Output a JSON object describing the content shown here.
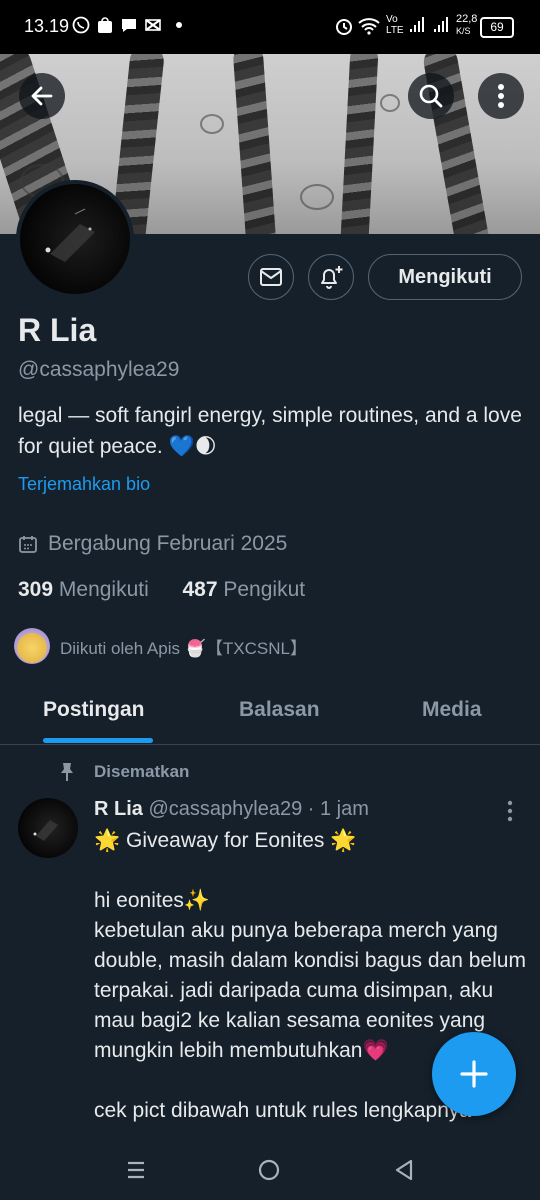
{
  "status_bar": {
    "time": "13.19",
    "network_speed": "22,8",
    "speed_unit": "K/S",
    "carrier_tag": "Vo LTE",
    "battery": "69",
    "icons": [
      "whatsapp-icon",
      "shopee-icon",
      "message-icon",
      "capcut-icon",
      "dot-icon",
      "alarm-icon",
      "wifi-icon",
      "signal-icon",
      "signal-icon",
      "battery-icon"
    ]
  },
  "header": {
    "back_icon": "back-arrow-icon",
    "search_icon": "search-icon",
    "more_icon": "more-vertical-icon"
  },
  "profile": {
    "name": "R Lia",
    "handle": "@cassaphylea29",
    "bio": "legal — soft fangirl energy, simple routines, and a love for quiet peace. 💙🌒",
    "translate_bio": "Terjemahkan bio",
    "joined": "Bergabung Februari 2025",
    "following_count": "309",
    "following_label": "Mengikuti",
    "followers_count": "487",
    "followers_label": "Pengikut",
    "followed_by": "Diikuti oleh Apis 🍧【TXCSNL】",
    "follow_button": "Mengikuti"
  },
  "tabs": [
    {
      "label": "Postingan",
      "active": true
    },
    {
      "label": "Balasan",
      "active": false
    },
    {
      "label": "Media",
      "active": false
    }
  ],
  "post": {
    "pinned_label": "Disematkan",
    "author": "R Lia",
    "handle": "@cassaphylea29",
    "time": "· 1 jam",
    "body": "🌟 Giveaway for Eonites 🌟\n\nhi eonites✨\nkebetulan aku punya beberapa merch yang double, masih dalam kondisi bagus dan belum terpakai. jadi daripada cuma disimpan, aku mau bagi2 ke kalian sesama eonites yang mungkin lebih membutuhkan💗\n\ncek pict dibawah untuk rules lengkapnya"
  },
  "colors": {
    "background": "#15202b",
    "accent": "#1d9bf0",
    "muted": "#8b98a5",
    "text": "#e7e9ea"
  }
}
